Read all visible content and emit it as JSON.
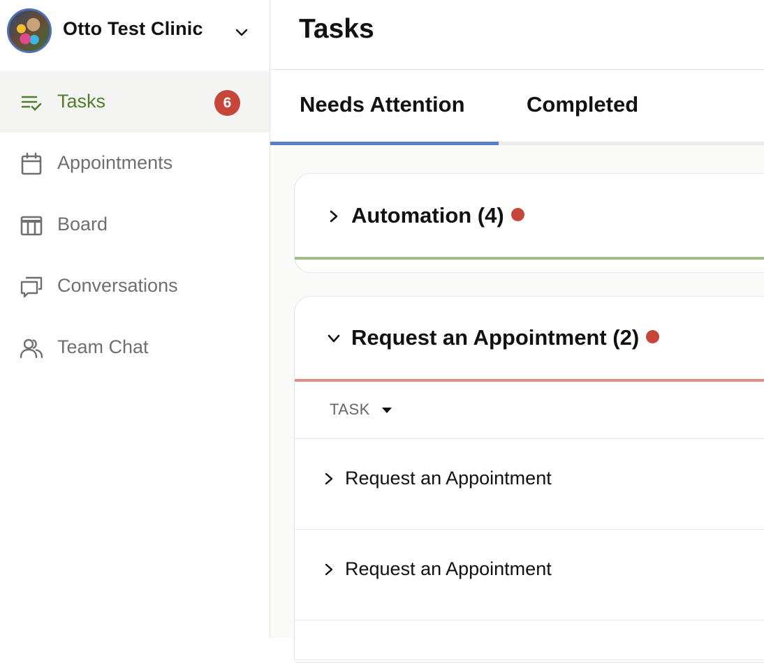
{
  "clinic": {
    "name": "Otto Test Clinic"
  },
  "nav": {
    "items": [
      {
        "label": "Tasks",
        "icon": "tasks-icon",
        "badge": "6",
        "active": true
      },
      {
        "label": "Appointments",
        "icon": "calendar-icon"
      },
      {
        "label": "Board",
        "icon": "board-icon"
      },
      {
        "label": "Conversations",
        "icon": "conversations-icon"
      },
      {
        "label": "Team Chat",
        "icon": "team-icon"
      }
    ]
  },
  "page": {
    "title": "Tasks"
  },
  "tabs": [
    {
      "label": "Needs Attention",
      "selected": true
    },
    {
      "label": "Completed"
    }
  ],
  "groups": [
    {
      "title": "Automation (4)",
      "expanded": false,
      "accent": "#a4bd87"
    },
    {
      "title": "Request an Appointment (2)",
      "expanded": true,
      "accent": "#dd8f88",
      "column_header": "TASK",
      "rows": [
        {
          "label": "Request an Appointment"
        },
        {
          "label": "Request an Appointment"
        }
      ]
    }
  ],
  "colors": {
    "active_nav": "#4e7d2c",
    "badge": "#c6463a",
    "tab_underline": "#5b7fc7",
    "alert_dot": "#c6463a"
  }
}
